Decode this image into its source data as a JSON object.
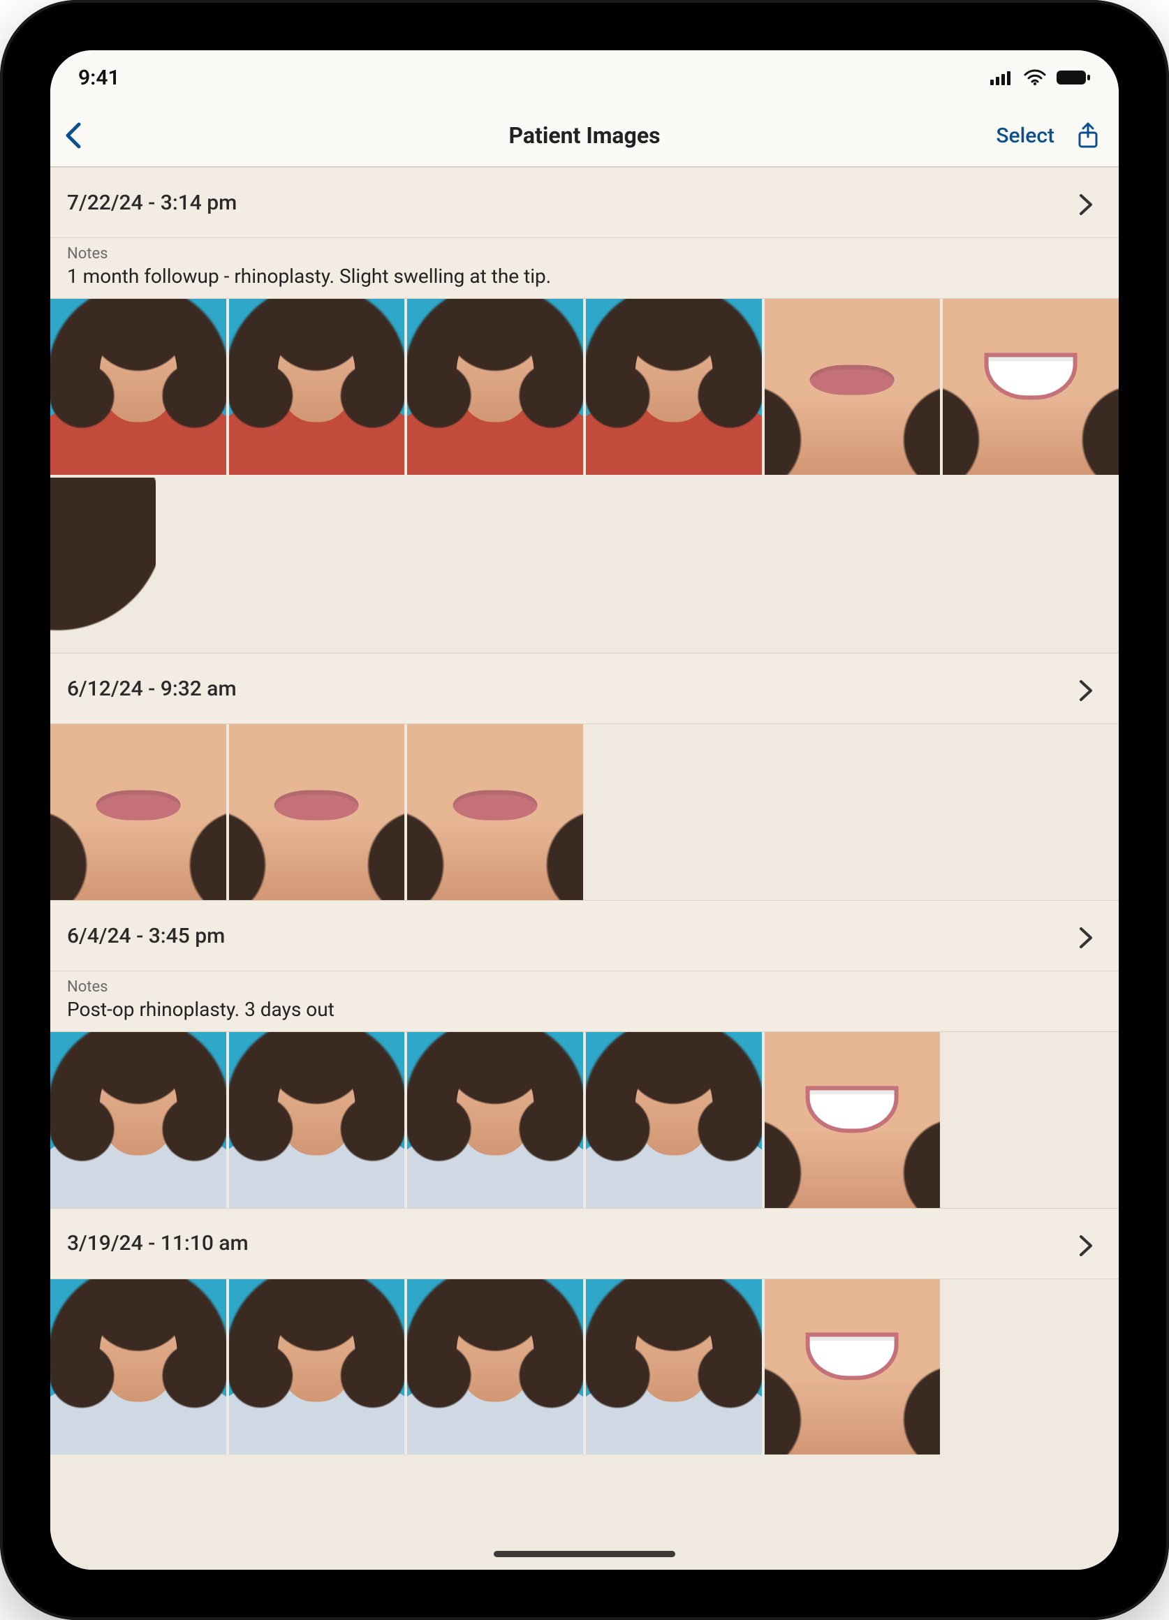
{
  "statusbar": {
    "time": "9:41"
  },
  "nav": {
    "title": "Patient Images",
    "select_label": "Select"
  },
  "sessions": [
    {
      "timestamp": "7/22/24 - 3:14 pm",
      "notes_label": "Notes",
      "notes": "1 month followup - rhinoplasty. Slight swelling at the tip.",
      "thumbs": [
        {
          "kind": "portrait",
          "shirt": "red"
        },
        {
          "kind": "portrait",
          "shirt": "red"
        },
        {
          "kind": "portrait",
          "shirt": "red"
        },
        {
          "kind": "portrait",
          "shirt": "red"
        },
        {
          "kind": "closeup",
          "smile": false
        },
        {
          "kind": "closeup",
          "smile": true
        },
        {
          "kind": "hair-only"
        }
      ]
    },
    {
      "timestamp": "6/12/24 - 9:32 am",
      "thumbs": [
        {
          "kind": "closeup",
          "smile": false
        },
        {
          "kind": "closeup",
          "smile": false
        },
        {
          "kind": "closeup",
          "smile": false
        }
      ]
    },
    {
      "timestamp": "6/4/24 - 3:45 pm",
      "notes_label": "Notes",
      "notes": "Post-op rhinoplasty. 3 days out",
      "thumbs": [
        {
          "kind": "portrait",
          "shirt": "blue"
        },
        {
          "kind": "portrait",
          "shirt": "blue"
        },
        {
          "kind": "portrait",
          "shirt": "blue"
        },
        {
          "kind": "portrait",
          "shirt": "blue"
        },
        {
          "kind": "closeup",
          "smile": true
        }
      ]
    },
    {
      "timestamp": "3/19/24 - 11:10 am",
      "thumbs": [
        {
          "kind": "portrait",
          "shirt": "blue"
        },
        {
          "kind": "portrait",
          "shirt": "blue"
        },
        {
          "kind": "portrait",
          "shirt": "blue"
        },
        {
          "kind": "portrait",
          "shirt": "blue"
        },
        {
          "kind": "closeup",
          "smile": true
        }
      ]
    }
  ]
}
